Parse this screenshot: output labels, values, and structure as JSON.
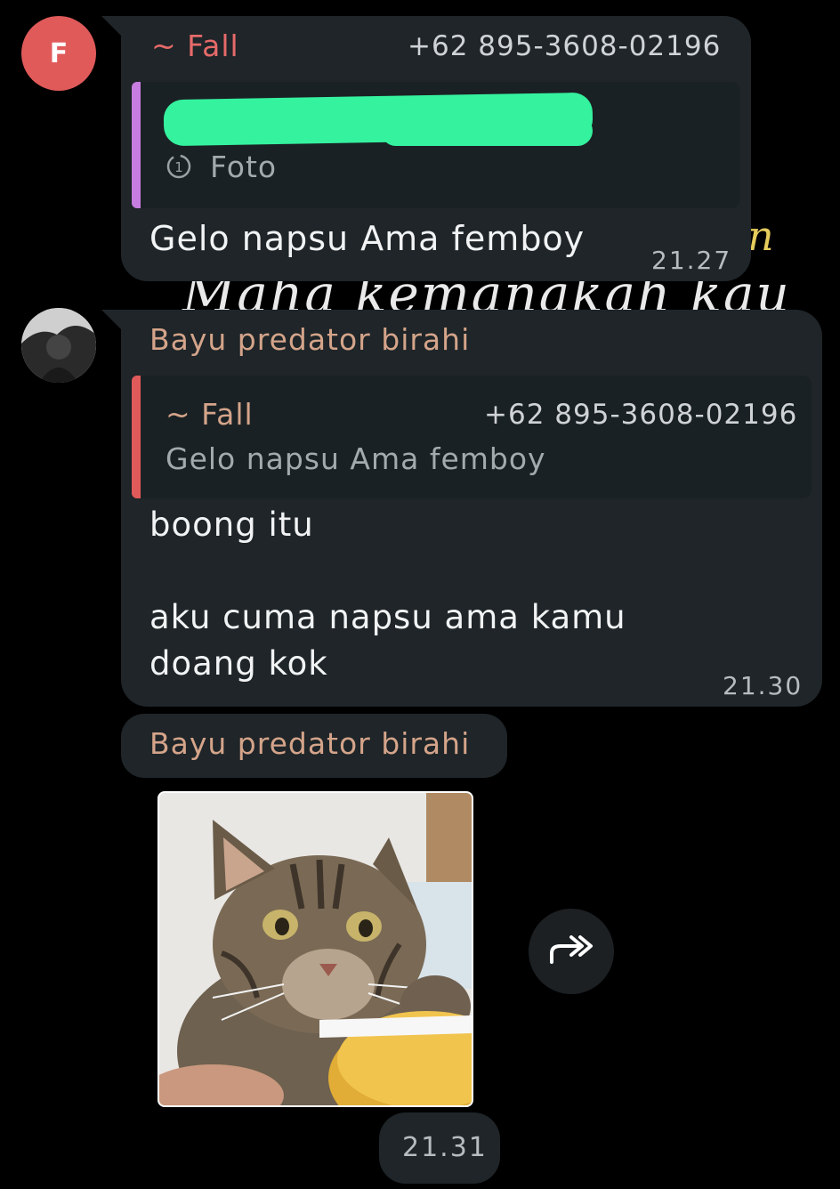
{
  "wallpaper": {
    "line1": "Maha kemanakah kau",
    "fragment": "n"
  },
  "message1": {
    "avatar_letter": "F",
    "sender": "~ Fall",
    "phone": "+62 895-3608-02196",
    "quote_type_icon": "view-once-icon",
    "quote_type": "Foto",
    "text": "Gelo napsu Ama femboy",
    "time": "21.27"
  },
  "message2": {
    "sender": "Bayu predator birahi",
    "quote_sender": "~ Fall",
    "quote_phone": "+62 895-3608-02196",
    "quote_text": "Gelo napsu Ama femboy",
    "text": "boong itu\n\naku cuma napsu ama kamu\ndoang kok",
    "time": "21.30"
  },
  "message3": {
    "sender": "Bayu predator birahi",
    "sticker": "cat-sticker",
    "forward_icon": "forward-icon",
    "time": "21.31"
  },
  "colors": {
    "background": "#000000",
    "bubble": "#1f2528",
    "sender_fall": "#e66a6a",
    "sender_bayu": "#d4a48a",
    "quote_bar_purple": "#c77ddf",
    "quote_bar_red": "#e05a5a",
    "scribble": "#35f29f"
  }
}
